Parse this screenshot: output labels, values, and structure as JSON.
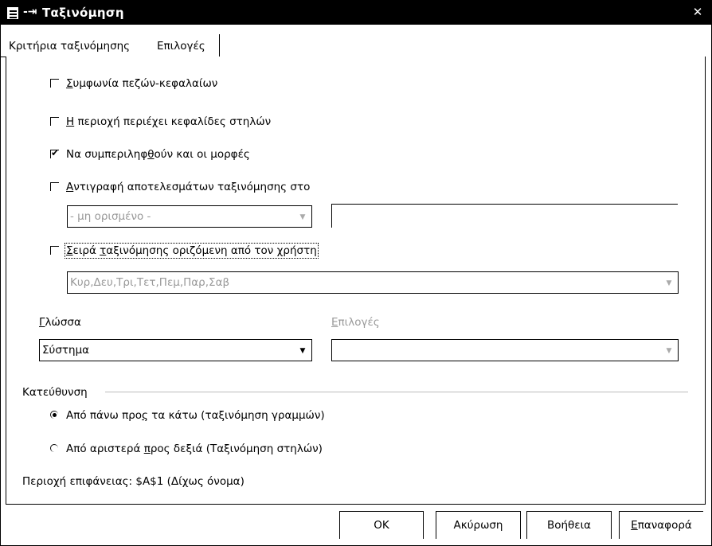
{
  "window": {
    "title": "Ταξινόμηση",
    "pin_glyph": "-⇥",
    "close_glyph": "✕"
  },
  "tabs": [
    {
      "label": "Κριτήρια ταξινόμησης"
    },
    {
      "label": "Επιλογές"
    }
  ],
  "options": {
    "case_sensitive": {
      "mnemonic": "Σ",
      "rest": "υμφωνία πεζών-κεφαλαίων",
      "checked": false
    },
    "has_headers": {
      "mnemonic": "Η",
      "rest": " περιοχή περιέχει κεφαλίδες στηλών",
      "checked": false
    },
    "include_formats": {
      "pre": "Να συμπεριληφ",
      "mnemonic": "θ",
      "rest": "ούν και οι μορφές",
      "checked": true
    },
    "copy_results": {
      "mnemonic": "Α",
      "rest": "ντιγραφή αποτελεσμάτων ταξινόμησης στο",
      "checked": false
    },
    "copy_target_select": "- μη ορισμένο -",
    "copy_target_input": "",
    "custom_order": {
      "mnemonic": "Σ",
      "mid1": "ειρά ",
      "mnemonic2": "τ",
      "rest": "αξινόμησης οριζόμενη από τον χρήστη",
      "checked": false
    },
    "custom_order_select": "Κυρ,Δευ,Τρι,Τετ,Πεμ,Παρ,Σαβ"
  },
  "language": {
    "label_mnemonic": "Γ",
    "label_rest": "λώσσα",
    "value": "Σύστημα",
    "options_label_mnemonic": "Ε",
    "options_label_rest": "πιλογές",
    "options_value": ""
  },
  "direction": {
    "section_label": "Κατεύθυνση",
    "top_to_bottom": {
      "pre": "Από πάνω προ",
      "mnemonic": "ς",
      "rest": " τα κάτω (ταξινόμηση γραμμών)",
      "selected": true
    },
    "left_to_right": {
      "pre": "Από αριστερά ",
      "mnemonic": "π",
      "rest": "ρος δεξιά (Ταξινόμηση στηλών)",
      "selected": false
    }
  },
  "area_info": "Περιοχή επιφάνειας: $A$1 (Δίχως όνομα)",
  "buttons": {
    "ok": "OK",
    "cancel": "Ακύρωση",
    "help": "Βοήθεια",
    "reset_mnemonic": "Ε",
    "reset_rest": "παναφορά"
  },
  "colors": {
    "titlebar": "#000000",
    "disabled_text": "#999999"
  }
}
